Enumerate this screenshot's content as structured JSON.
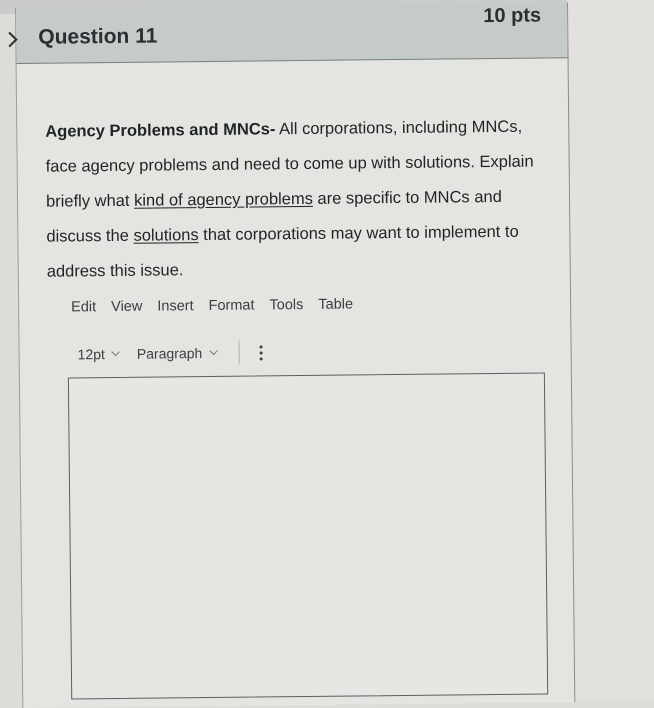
{
  "question": {
    "title": "Question 11",
    "points": "10 pts",
    "text": {
      "bold_lead": "Agency Problems and MNCs-",
      "part1": " All corporations, including MNCs, face agency problems and need to come up with solutions. Explain briefly what ",
      "underline1": "kind of agency problems",
      "part2": " are specific to MNCs and discuss the ",
      "underline2": "solutions",
      "part3": " that corporations may want to implement to address this issue."
    }
  },
  "editor": {
    "menu": [
      "Edit",
      "View",
      "Insert",
      "Format",
      "Tools",
      "Table"
    ],
    "font_size": "12pt",
    "block_format": "Paragraph",
    "content": ""
  }
}
